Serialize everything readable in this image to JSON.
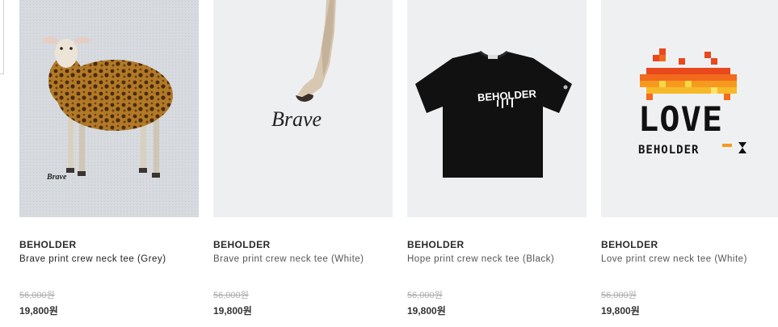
{
  "products": [
    {
      "brand": "BEHOLDER",
      "name": "Brave print crew neck tee (Grey)",
      "original_price": "56,000원",
      "sale_price": "19,800원",
      "image_text": "Brave",
      "icon": "leopard-sheep-print-icon",
      "bg_color": "#d5d8dd"
    },
    {
      "brand": "BEHOLDER",
      "name": "Brave print crew neck tee (White)",
      "original_price": "56,000원",
      "sale_price": "19,800원",
      "image_text": "Brave",
      "icon": "sheep-leg-print-icon",
      "bg_color": "#eeeff1"
    },
    {
      "brand": "BEHOLDER",
      "name": "Hope print crew neck tee (Black)",
      "original_price": "56,000원",
      "sale_price": "19,800원",
      "image_text": "BEHOLDER",
      "icon": "black-tshirt-icon",
      "bg_color": "#eeeff1"
    },
    {
      "brand": "BEHOLDER",
      "name": "Love print crew neck tee (White)",
      "original_price": "56,000원",
      "sale_price": "19,800원",
      "image_text": "LOVE",
      "image_subtext": "BEHOLDER",
      "icon": "pixel-fire-love-print-icon",
      "bg_color": "#eff0f2"
    }
  ]
}
